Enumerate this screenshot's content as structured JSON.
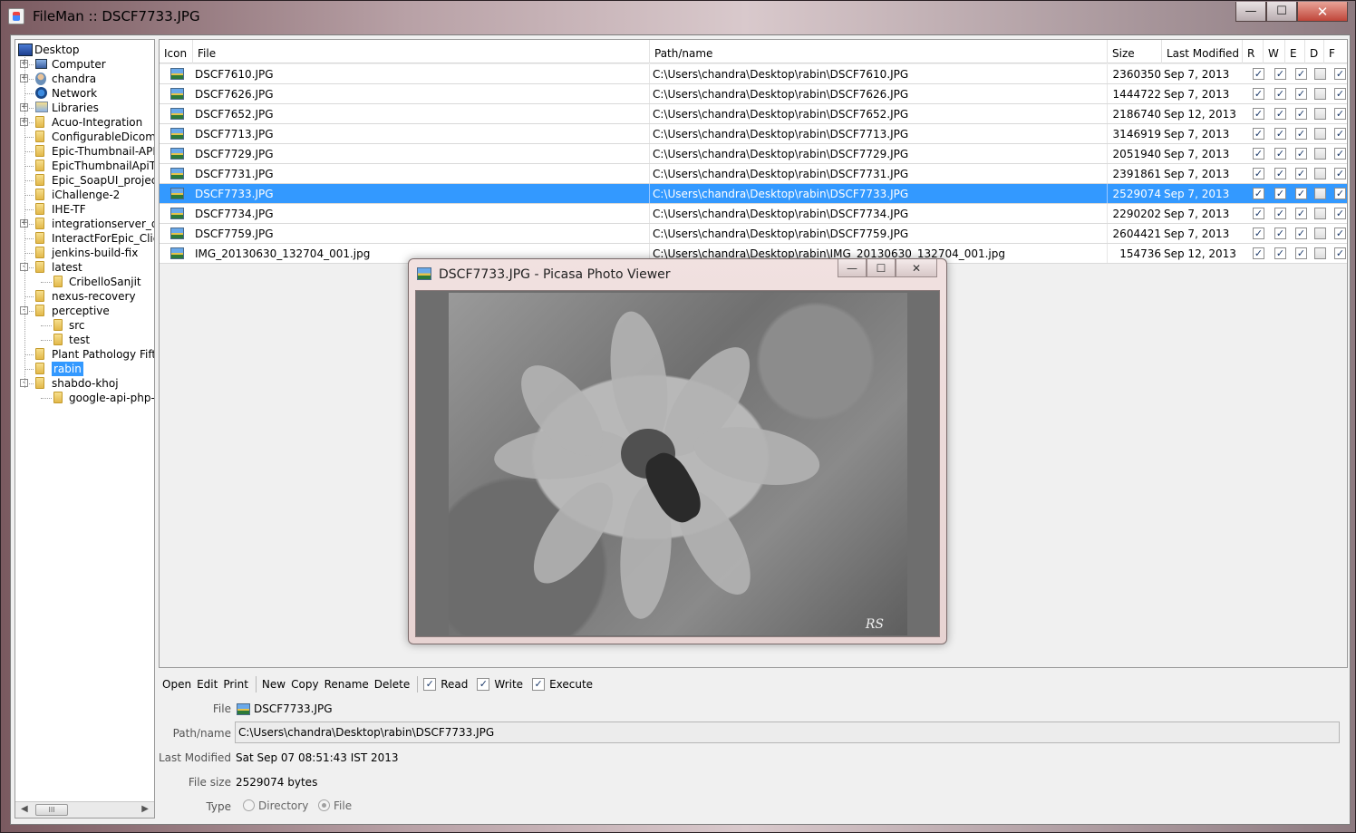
{
  "window": {
    "title": "FileMan :: DSCF7733.JPG",
    "min_glyph": "—",
    "max_glyph": "☐",
    "close_glyph": "✕"
  },
  "tree": {
    "nodes": [
      {
        "label": "Desktop",
        "icon": "desktop-icon"
      },
      {
        "label": "Computer",
        "icon": "computer-icon"
      },
      {
        "label": "chandra",
        "icon": "user-icon"
      },
      {
        "label": "Network",
        "icon": "network-icon"
      },
      {
        "label": "Libraries",
        "icon": "libraries-icon"
      },
      {
        "label": "Acuo-Integration",
        "icon": "folder-icon"
      },
      {
        "label": "ConfigurableDicomU",
        "icon": "folder-icon"
      },
      {
        "label": "Epic-Thumbnail-API",
        "icon": "folder-icon"
      },
      {
        "label": "EpicThumbnailApiTe",
        "icon": "folder-icon"
      },
      {
        "label": "Epic_SoapUI_projec",
        "icon": "folder-icon"
      },
      {
        "label": "iChallenge-2",
        "icon": "folder-icon"
      },
      {
        "label": "IHE-TF",
        "icon": "folder-icon"
      },
      {
        "label": "integrationserver_d",
        "icon": "folder-icon"
      },
      {
        "label": "InteractForEpic_Clie",
        "icon": "folder-icon"
      },
      {
        "label": "jenkins-build-fix",
        "icon": "folder-icon"
      },
      {
        "label": "latest",
        "icon": "folder-icon"
      },
      {
        "label": "CribelloSanjit",
        "icon": "folder-icon"
      },
      {
        "label": "nexus-recovery",
        "icon": "folder-icon"
      },
      {
        "label": "perceptive",
        "icon": "folder-icon"
      },
      {
        "label": "src",
        "icon": "folder-icon"
      },
      {
        "label": "test",
        "icon": "folder-icon"
      },
      {
        "label": "Plant Pathology  Fift",
        "icon": "folder-icon"
      },
      {
        "label": "rabin",
        "icon": "folder-icon"
      },
      {
        "label": "shabdo-khoj",
        "icon": "folder-icon"
      },
      {
        "label": "google-api-php-",
        "icon": "folder-icon"
      }
    ],
    "scroll_thumb": "III"
  },
  "table": {
    "headers": [
      "Icon",
      "File",
      "Path/name",
      "Size",
      "Last Modified",
      "R",
      "W",
      "E",
      "D",
      "F"
    ],
    "rows": [
      {
        "file": "DSCF7610.JPG",
        "path": "C:\\Users\\chandra\\Desktop\\rabin\\DSCF7610.JPG",
        "size": "2360350",
        "modified": "Sep 7, 2013",
        "r": true,
        "w": true,
        "e": true,
        "d": false,
        "f": true
      },
      {
        "file": "DSCF7626.JPG",
        "path": "C:\\Users\\chandra\\Desktop\\rabin\\DSCF7626.JPG",
        "size": "1444722",
        "modified": "Sep 7, 2013",
        "r": true,
        "w": true,
        "e": true,
        "d": false,
        "f": true
      },
      {
        "file": "DSCF7652.JPG",
        "path": "C:\\Users\\chandra\\Desktop\\rabin\\DSCF7652.JPG",
        "size": "2186740",
        "modified": "Sep 12, 2013",
        "r": true,
        "w": true,
        "e": true,
        "d": false,
        "f": true
      },
      {
        "file": "DSCF7713.JPG",
        "path": "C:\\Users\\chandra\\Desktop\\rabin\\DSCF7713.JPG",
        "size": "3146919",
        "modified": "Sep 7, 2013",
        "r": true,
        "w": true,
        "e": true,
        "d": false,
        "f": true
      },
      {
        "file": "DSCF7729.JPG",
        "path": "C:\\Users\\chandra\\Desktop\\rabin\\DSCF7729.JPG",
        "size": "2051940",
        "modified": "Sep 7, 2013",
        "r": true,
        "w": true,
        "e": true,
        "d": false,
        "f": true
      },
      {
        "file": "DSCF7731.JPG",
        "path": "C:\\Users\\chandra\\Desktop\\rabin\\DSCF7731.JPG",
        "size": "2391861",
        "modified": "Sep 7, 2013",
        "r": true,
        "w": true,
        "e": true,
        "d": false,
        "f": true
      },
      {
        "file": "DSCF7733.JPG",
        "path": "C:\\Users\\chandra\\Desktop\\rabin\\DSCF7733.JPG",
        "size": "2529074",
        "modified": "Sep 7, 2013",
        "r": true,
        "w": true,
        "e": true,
        "d": false,
        "f": true,
        "selected": true
      },
      {
        "file": "DSCF7734.JPG",
        "path": "C:\\Users\\chandra\\Desktop\\rabin\\DSCF7734.JPG",
        "size": "2290202",
        "modified": "Sep 7, 2013",
        "r": true,
        "w": true,
        "e": true,
        "d": false,
        "f": true
      },
      {
        "file": "DSCF7759.JPG",
        "path": "C:\\Users\\chandra\\Desktop\\rabin\\DSCF7759.JPG",
        "size": "2604421",
        "modified": "Sep 7, 2013",
        "r": true,
        "w": true,
        "e": true,
        "d": false,
        "f": true
      },
      {
        "file": "IMG_20130630_132704_001.jpg",
        "path": "C:\\Users\\chandra\\Desktop\\rabin\\IMG_20130630_132704_001.jpg",
        "size": "154736",
        "modified": "Sep 12, 2013",
        "r": true,
        "w": true,
        "e": true,
        "d": false,
        "f": true
      }
    ],
    "check_glyph": "✓"
  },
  "toolbar": {
    "open": "Open",
    "edit": "Edit",
    "print": "Print",
    "new": "New",
    "copy": "Copy",
    "rename": "Rename",
    "delete": "Delete",
    "read": "Read",
    "write": "Write",
    "execute": "Execute",
    "check_glyph": "✓"
  },
  "details": {
    "file_label": "File",
    "file_value": "DSCF7733.JPG",
    "path_label": "Path/name",
    "path_value": "C:\\Users\\chandra\\Desktop\\rabin\\DSCF7733.JPG",
    "modified_label": "Last Modified",
    "modified_value": "Sat Sep 07 08:51:43 IST 2013",
    "size_label": "File size",
    "size_value": "2529074 bytes",
    "type_label": "Type",
    "type_directory": "Directory",
    "type_file": "File"
  },
  "viewer": {
    "title": "DSCF7733.JPG - Picasa Photo Viewer",
    "signature": "RS",
    "min_glyph": "—",
    "max_glyph": "☐",
    "close_glyph": "✕"
  },
  "colors": {
    "selection": "#3399ff",
    "window_bg": "#f0f0f0"
  }
}
